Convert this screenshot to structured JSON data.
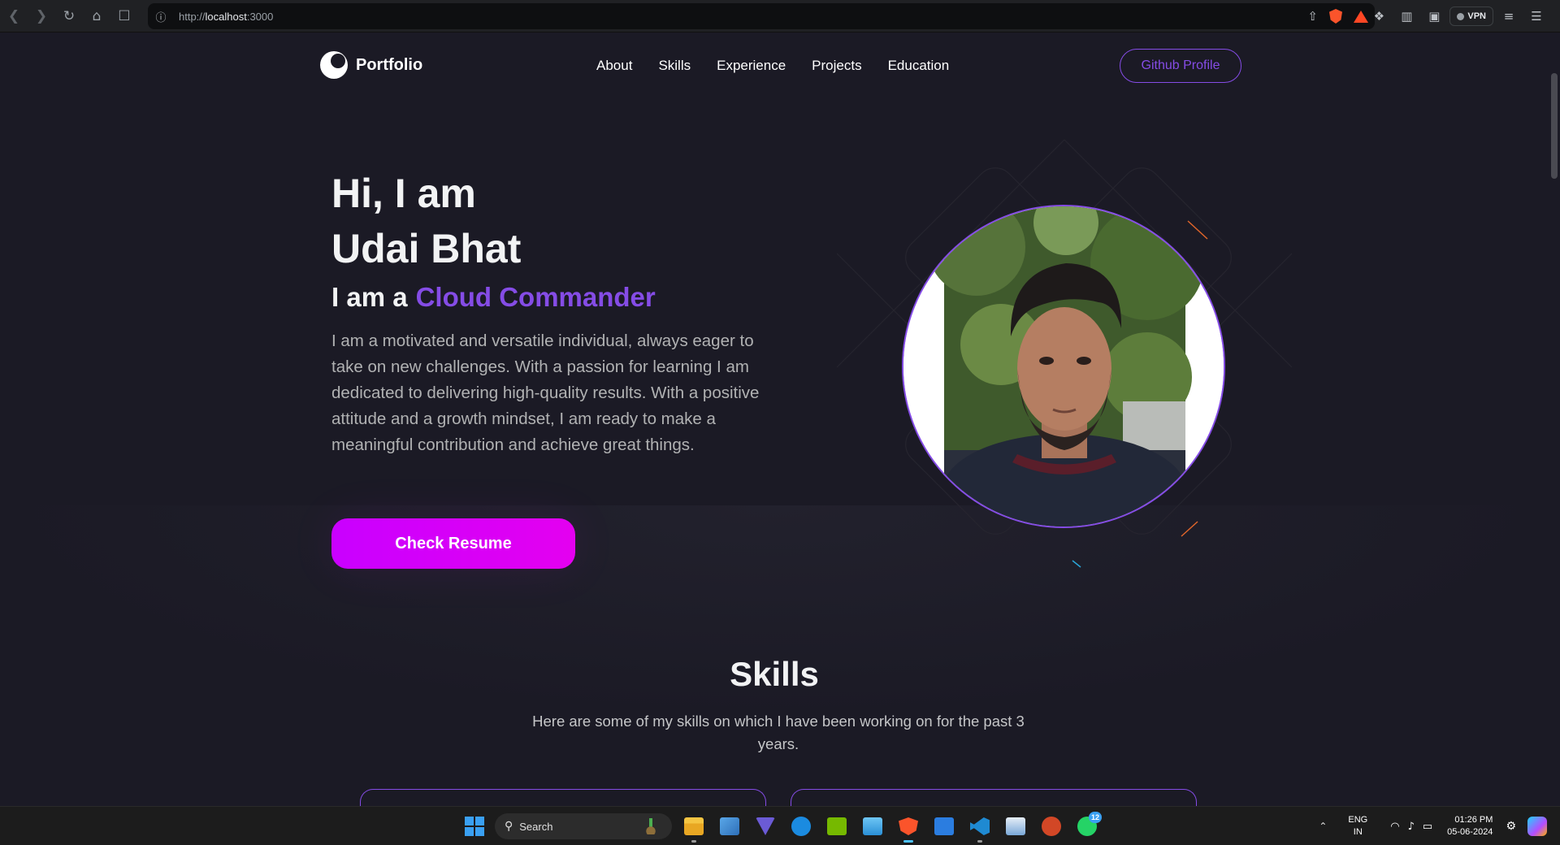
{
  "browser": {
    "url_scheme": "http://",
    "url_host": "localhost",
    "url_port": ":3000",
    "vpn_label": "VPN"
  },
  "header": {
    "logo_text": "Portfolio",
    "nav": [
      "About",
      "Skills",
      "Experience",
      "Projects",
      "Education"
    ],
    "github_label": "Github Profile"
  },
  "hero": {
    "title_line1": "Hi, I am",
    "title_line2": "Udai Bhat",
    "role_prefix": "I am a",
    "role_highlight": "Cloud Commander",
    "description": "I am a motivated and versatile individual, always eager to take on new challenges. With a passion for learning I am dedicated to delivering high-quality results. With a positive attitude and a growth mindset, I am ready to make a meaningful contribution and achieve great things.",
    "resume_label": "Check Resume"
  },
  "skills": {
    "title": "Skills",
    "description": "Here are some of my skills on which I have been working on for the past 3 years."
  },
  "taskbar": {
    "search_label": "Search",
    "whatsapp_badge": "12",
    "lang_line1": "ENG",
    "lang_line2": "IN",
    "time": "01:26 PM",
    "date": "05-06-2024"
  },
  "colors": {
    "accent": "#854ce6",
    "background": "#1b1a25",
    "button_gradient_start": "#c900ff",
    "button_gradient_end": "#e400f0"
  }
}
